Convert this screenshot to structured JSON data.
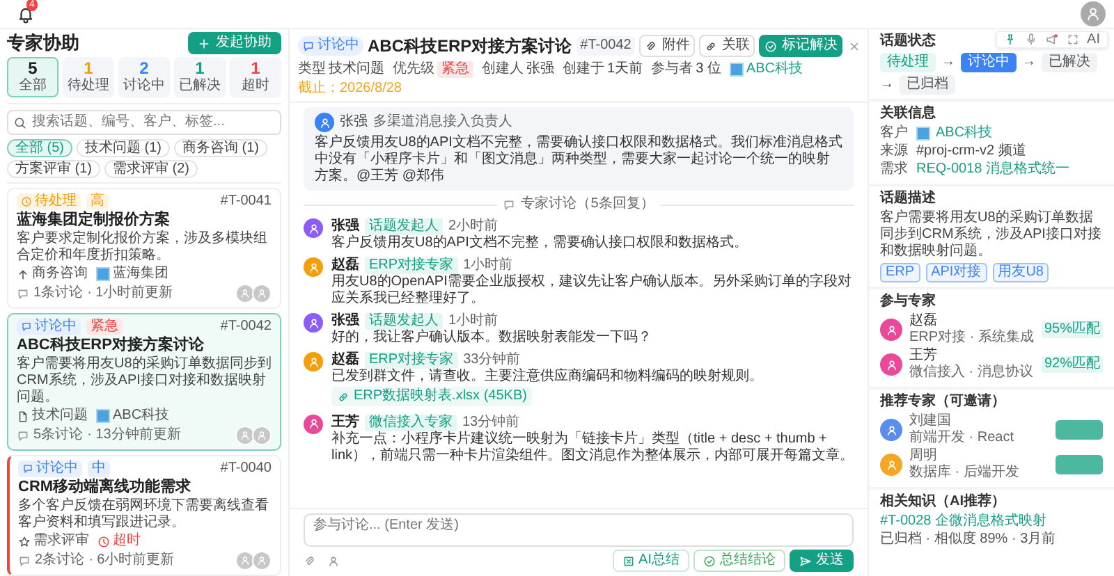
{
  "top_bar": {
    "notification_count": "4"
  },
  "sidebar": {
    "title": "专家协助",
    "new_button": "发起协助",
    "stats": [
      {
        "count": "5",
        "label": "全部",
        "color": "#222222",
        "selected": true
      },
      {
        "count": "1",
        "label": "待处理",
        "color": "#f59e0b",
        "selected": false
      },
      {
        "count": "2",
        "label": "讨论中",
        "color": "#3b82f6",
        "selected": false
      },
      {
        "count": "1",
        "label": "已解决",
        "color": "#14a085",
        "selected": false
      },
      {
        "count": "1",
        "label": "超时",
        "color": "#ef4444",
        "selected": false
      }
    ],
    "search": {
      "placeholder": "搜索话题、编号、客户、标签..."
    },
    "filters": [
      {
        "label": "全部 (5)",
        "selected": true
      },
      {
        "label": "技术问题 (1)",
        "selected": false
      },
      {
        "label": "商务咨询 (1)",
        "selected": false
      },
      {
        "label": "方案评审 (1)",
        "selected": false
      },
      {
        "label": "需求评审 (2)",
        "selected": false
      }
    ],
    "topics": [
      {
        "status": {
          "label": "待处理",
          "kind": "pending"
        },
        "priority": {
          "label": "高",
          "kind": "high"
        },
        "id": "#T-0041",
        "title": "蓝海集团定制报价方案",
        "desc": "客户要求定制化报价方案，涉及多模块组合定价和年度折扣策略。",
        "meta": [
          {
            "kind": "business",
            "text": "商务咨询"
          },
          {
            "kind": "customer",
            "text": "蓝海集团"
          }
        ],
        "replies": "1条讨论",
        "updated": "· 1小时前更新",
        "selected": false,
        "overdue": false
      },
      {
        "status": {
          "label": "讨论中",
          "kind": "discussing"
        },
        "priority": {
          "label": "紧急",
          "kind": "urgent"
        },
        "id": "#T-0042",
        "title": "ABC科技ERP对接方案讨论",
        "desc": "客户需要将用友U8的采购订单数据同步到CRM系统，涉及API接口对接和数据映射问题。",
        "meta": [
          {
            "kind": "tech",
            "text": "技术问题"
          },
          {
            "kind": "customer",
            "text": "ABC科技"
          }
        ],
        "replies": "5条讨论",
        "updated": "· 13分钟前更新",
        "selected": true,
        "overdue": false
      },
      {
        "status": {
          "label": "讨论中",
          "kind": "discussing"
        },
        "priority": {
          "label": "中",
          "kind": "medium"
        },
        "id": "#T-0040",
        "title": "CRM移动端离线功能需求",
        "desc": "多个客户反馈在弱网环境下需要离线查看客户资料和填写跟进记录。",
        "meta": [
          {
            "kind": "review",
            "text": "需求评审"
          },
          {
            "kind": "overdue",
            "text": "超时"
          }
        ],
        "replies": "2条讨论",
        "updated": "· 6小时前更新",
        "selected": false,
        "overdue": true
      }
    ]
  },
  "thread": {
    "status": "讨论中",
    "title": "ABC科技ERP对接方案讨论",
    "id": "#T-0042",
    "buttons": [
      {
        "label": "附件",
        "kind": "attach"
      },
      {
        "label": "关联",
        "kind": "link"
      },
      {
        "label": "标记解决",
        "kind": "resolve"
      }
    ],
    "meta": [
      {
        "kind": "text",
        "label": "类型",
        "value": "技术问题"
      },
      {
        "kind": "badge",
        "label": "优先级",
        "value": "紧急"
      },
      {
        "kind": "text",
        "label": "创建人",
        "value": "张强"
      },
      {
        "kind": "text",
        "label": "创建于",
        "value": "1天前"
      },
      {
        "kind": "text",
        "label": "参与者",
        "value": "3 位"
      },
      {
        "kind": "customer",
        "value": "ABC科技"
      },
      {
        "kind": "deadline",
        "value": "截止：2026/8/28"
      }
    ],
    "original": {
      "author": "张强",
      "role": "多渠道消息接入负责人",
      "color": "#3b82f6",
      "text": "客户反馈用友U8的API文档不完整，需要确认接口权限和数据格式。我们标准消息格式中没有「小程序卡片」和「图文消息」两种类型，需要大家一起讨论一个统一的映射方案。@王芳 @郑伟"
    },
    "divider": "专家讨论（5条回复）",
    "replies": [
      {
        "author": "张强",
        "role": "话题发起人",
        "time": "2小时前",
        "color": "#8b5cf6",
        "text": "客户反馈用友U8的API文档不完整，需要确认接口权限和数据格式。"
      },
      {
        "author": "赵磊",
        "role": "ERP对接专家",
        "time": "1小时前",
        "color": "#f59e0b",
        "text": "用友U8的OpenAPI需要企业版授权，建议先让客户确认版本。另外采购订单的字段对应关系我已经整理好了。"
      },
      {
        "author": "张强",
        "role": "话题发起人",
        "time": "1小时前",
        "color": "#8b5cf6",
        "text": "好的，我让客户确认版本。数据映射表能发一下吗？"
      },
      {
        "author": "赵磊",
        "role": "ERP对接专家",
        "time": "33分钟前",
        "color": "#f59e0b",
        "text": "已发到群文件，请查收。主要注意供应商编码和物料编码的映射规则。",
        "attachment": "ERP数据映射表.xlsx (45KB)"
      },
      {
        "author": "王芳",
        "role": "微信接入专家",
        "time": "13分钟前",
        "color": "#ec4899",
        "text": "补充一点：小程序卡片建议统一映射为「链接卡片」类型（title + desc + thumb + link），前端只需一种卡片渲染组件。图文消息作为整体展示，内部可展开每篇文章。"
      }
    ],
    "composer": {
      "placeholder": "参与讨论... (Enter 发送)",
      "buttons": [
        {
          "label": "AI总结",
          "kind": "ai"
        },
        {
          "label": "总结结论",
          "kind": "conclude"
        },
        {
          "label": "发送",
          "kind": "send"
        }
      ]
    }
  },
  "details": {
    "toolbar_label": "AI",
    "status": {
      "title": "话题状态",
      "arrow": "→",
      "steps": [
        {
          "label": "待处理",
          "selected": false
        },
        {
          "label": "讨论中",
          "selected": true
        },
        {
          "label": "已解决",
          "selected": false
        },
        {
          "label": "已归档",
          "selected": false
        }
      ]
    },
    "related": {
      "title": "关联信息",
      "rows": [
        {
          "label": "客户",
          "value": "ABC科技",
          "kind": "customer"
        },
        {
          "label": "来源",
          "value": "#proj-crm-v2 频道",
          "kind": "text"
        },
        {
          "label": "需求",
          "value": "REQ-0018 消息格式统一",
          "kind": "link"
        }
      ]
    },
    "description": {
      "title": "话题描述",
      "text": "客户需要将用友U8的采购订单数据同步到CRM系统，涉及API接口对接和数据映射问题。",
      "tags": [
        "ERP",
        "API对接",
        "用友U8"
      ]
    },
    "experts": {
      "title": "参与专家",
      "items": [
        {
          "name": "赵磊",
          "skill": "ERP对接 · 系统集成",
          "match": "95%匹配",
          "color": "#ec4899"
        },
        {
          "name": "王芳",
          "skill": "微信接入 · 消息协议",
          "match": "92%匹配",
          "color": "#ec4899"
        }
      ]
    },
    "recommended": {
      "title": "推荐专家（可邀请）",
      "items": [
        {
          "name": "刘建国",
          "skill": "前端开发 · React",
          "color": "#5b8def"
        },
        {
          "name": "周明",
          "skill": "数据库 · 后端开发",
          "color": "#f5a623"
        }
      ]
    },
    "knowledge": {
      "title": "相关知识（AI推荐）",
      "link": "#T-0028 企微消息格式映射",
      "meta": "已归档 · 相似度 89% · 3月前"
    }
  }
}
